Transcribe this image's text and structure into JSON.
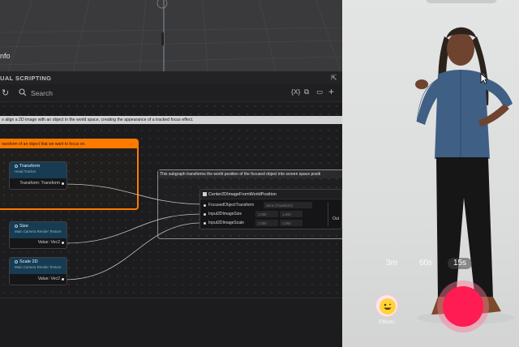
{
  "viewport": {
    "info_label": "nfo"
  },
  "visual_scripting": {
    "panel_title": "UAL SCRIPTING",
    "search_placeholder": "Search",
    "toolbar_buttons": [
      "{X}",
      "⧉",
      "▭",
      "+"
    ]
  },
  "comment_bar": {
    "text": "o align a 2D image with an object in the world space, creating the appearance of a tracked focus effect."
  },
  "orange_group": {
    "text": "ransform of an object that we want to focus on."
  },
  "grey_group": {
    "text": "This subgraph transforms the world position of the focused object into screen space positi"
  },
  "nodes": {
    "transform": {
      "title": "Transform",
      "subtitle": "Head Tracker",
      "port": "Transform: Transform"
    },
    "size": {
      "title": "Size",
      "subtitle": "Main Camera Render Texture",
      "port": "Value: Vec2"
    },
    "scale2d": {
      "title": "Scale 2D",
      "subtitle": "Main Camera Render Texture",
      "port": "Value: Vec2"
    }
  },
  "subgraph_node": {
    "title": "Center2DImageFromWorldPosition",
    "inputs": [
      {
        "label": "FocusedObjectTransform",
        "field": "None (Transform)"
      },
      {
        "label": "Input2DImageSize",
        "field_a": "1.000",
        "field_b": "1.000"
      },
      {
        "label": "Input2DImageScale",
        "field_a": "1.000",
        "field_b": "1.000"
      }
    ],
    "output": "Out"
  },
  "camera": {
    "durations": [
      "3m",
      "60s",
      "15s"
    ],
    "selected_duration": "15s",
    "effects_label": "Effects",
    "colors": {
      "record": "#ff1c52",
      "effects_bg": "#ffe6ec"
    }
  }
}
